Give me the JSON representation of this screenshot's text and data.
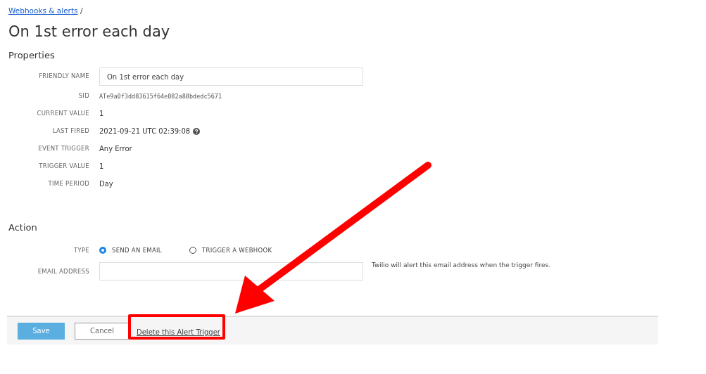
{
  "breadcrumb": {
    "link": "Webhooks & alerts",
    "separator": "/"
  },
  "title": "On 1st error each day",
  "properties": {
    "heading": "Properties",
    "rows": [
      {
        "label": "FRIENDLY NAME",
        "kind": "input",
        "value": "On 1st error each day"
      },
      {
        "label": "SID",
        "kind": "mono",
        "value": "ATe9a0f3dd83615f64e082a88bdedc5671"
      },
      {
        "label": "CURRENT VALUE",
        "kind": "text",
        "value": "1"
      },
      {
        "label": "LAST FIRED",
        "kind": "help",
        "value": "2021-09-21 UTC 02:39:08"
      },
      {
        "label": "EVENT TRIGGER",
        "kind": "text",
        "value": "Any Error"
      },
      {
        "label": "TRIGGER VALUE",
        "kind": "text",
        "value": "1"
      },
      {
        "label": "TIME PERIOD",
        "kind": "text",
        "value": "Day"
      }
    ]
  },
  "action": {
    "heading": "Action",
    "type_label": "TYPE",
    "types": [
      {
        "label": "SEND AN EMAIL",
        "selected": true
      },
      {
        "label": "TRIGGER A WEBHOOK",
        "selected": false
      }
    ],
    "email_label": "EMAIL ADDRESS",
    "email_hint": "Twilio will alert this email address when the trigger fires."
  },
  "footer": {
    "save": "Save",
    "cancel": "Cancel",
    "delete": "Delete this Alert Trigger"
  },
  "annotation": {
    "highlight": true,
    "arrow": true
  }
}
